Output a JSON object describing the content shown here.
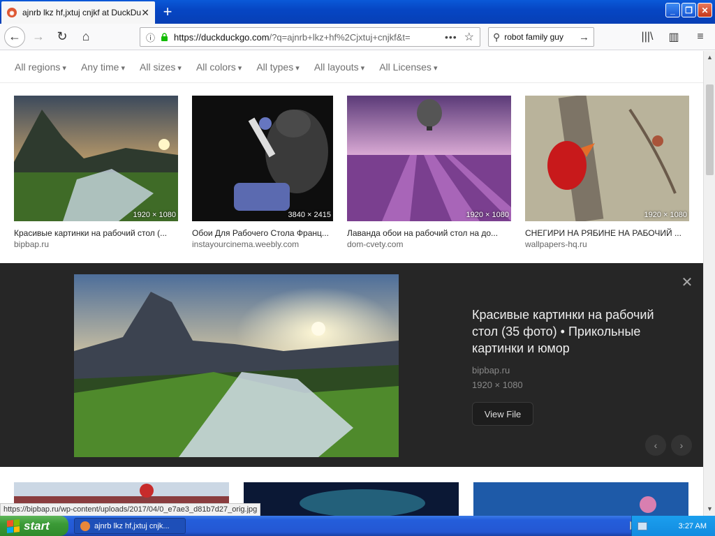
{
  "browser": {
    "tab_title": "ajnrb lkz hf,jxtuj cnjkf at DuckDuckGo",
    "url_host": "https://duckduckgo.com",
    "url_rest": "/?q=ajnrb+lkz+hf%2Cjxtuj+cnjkf&t=",
    "search_text": "robot family guy"
  },
  "filters": [
    "All regions",
    "Any time",
    "All sizes",
    "All colors",
    "All types",
    "All layouts",
    "All Licenses"
  ],
  "results": [
    {
      "title": "Красивые картинки на рабочий стол (...",
      "source": "bipbap.ru",
      "dimensions": "1920 × 1080"
    },
    {
      "title": "Обои Для Рабочего Стола Франц...",
      "source": "instayourcinema.weebly.com",
      "dimensions": "3840 × 2415"
    },
    {
      "title": "Лаванда обои на рабочий стол на до...",
      "source": "dom-cvety.com",
      "dimensions": "1920 × 1080"
    },
    {
      "title": "СНЕГИРИ НА РЯБИНЕ НА РАБОЧИЙ ...",
      "source": "wallpapers-hq.ru",
      "dimensions": "1920 × 1080"
    }
  ],
  "detail": {
    "title": "Красивые картинки на рабочий стол (35 фото) • Прикольные картинки и юмор",
    "source": "bipbap.ru",
    "dimensions": "1920 × 1080",
    "view_button": "View File"
  },
  "status_url": "https://bipbap.ru/wp-content/uploads/2017/04/0_e7ae3_d81b7d27_orig.jpg",
  "taskbar": {
    "start_label": "start",
    "task_label": "ajnrb lkz hf,jxtuj cnjk...",
    "clock": "3:27 AM"
  }
}
